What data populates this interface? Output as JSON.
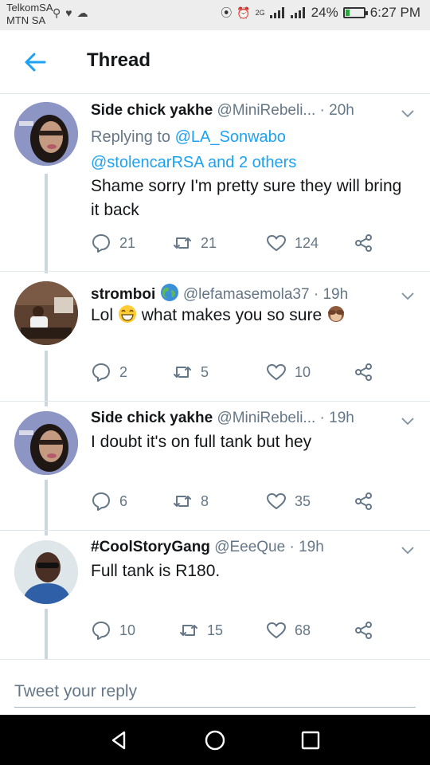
{
  "status_bar": {
    "carrier_1": "TelkomSA",
    "carrier_2": "MTN SA",
    "network_label": "2G",
    "battery": "24%",
    "battery_level": 0.24,
    "time": "6:27 PM"
  },
  "header": {
    "title": "Thread"
  },
  "tweets": [
    {
      "name": "Side chick yakhe",
      "handle": "@MiniRebeli...",
      "time": "20h",
      "replying_prefix": "Replying to",
      "replying_user": "@LA_Sonwabo",
      "replying_more": "@stolencarRSA and 2 others",
      "text": "Shame sorry I'm pretty sure they will bring it back",
      "replies": "21",
      "retweets": "21",
      "likes": "124"
    },
    {
      "name": "stromboi",
      "handle": "@lefamasemola37",
      "time": "19h",
      "text_a": "Lol",
      "text_b": "what makes you so sure",
      "replies": "2",
      "retweets": "5",
      "likes": "10"
    },
    {
      "name": "Side chick yakhe",
      "handle": "@MiniRebeli...",
      "time": "19h",
      "text": "I doubt it's on full tank but hey",
      "replies": "6",
      "retweets": "8",
      "likes": "35"
    },
    {
      "name": "#CoolStoryGang",
      "handle": "@EeeQue",
      "time": "19h",
      "text": "Full tank is R180.",
      "replies": "10",
      "retweets": "15",
      "likes": "68"
    }
  ],
  "reply_box": {
    "placeholder": "Tweet your reply"
  },
  "colors": {
    "accent": "#1da1f2",
    "secondary_text": "#657786",
    "thread_line": "#ccd6dd",
    "battery_fill": "#2ba640"
  },
  "icons": [
    "back-arrow-icon",
    "chevron-down-icon",
    "reply-icon",
    "retweet-icon",
    "like-icon",
    "share-icon",
    "globe-emoji-icon",
    "grinning-emoji-icon",
    "see-no-evil-monkey-emoji-icon",
    "nav-back-icon",
    "nav-home-icon",
    "nav-recents-icon"
  ]
}
